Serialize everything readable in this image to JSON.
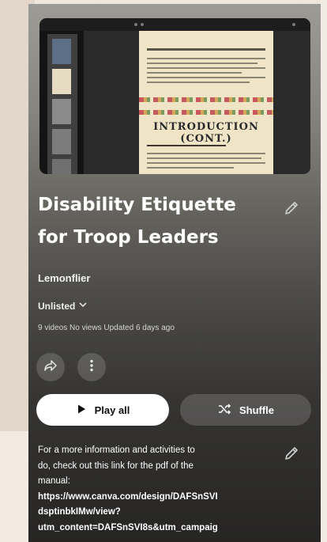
{
  "playlist": {
    "title_line1": "Disability Etiquette",
    "title_line2": "for Troop Leaders",
    "owner": "Lemonflier",
    "privacy": "Unlisted",
    "meta": "9 videos  No views  Updated 6 days ago"
  },
  "thumbnail": {
    "heading": "INTRODUCTION (CONT.)"
  },
  "actions": {
    "play_all_label": "Play all",
    "shuffle_label": "Shuffle"
  },
  "description": {
    "text_line1": "For a more information and activities to",
    "text_line2": "do, check out this link for the pdf of the",
    "text_line3": "manual:",
    "link_line1": "https://www.canva.com/design/DAFSnSVI",
    "link_line2": "dsptinbkIMw/view?",
    "link_line3": "utm_content=DAFSnSVI8s&utm_campaig"
  },
  "icons": {
    "edit_title": "pencil-icon",
    "edit_description": "pencil-icon",
    "share": "share-icon",
    "more": "more-vert-icon",
    "play": "play-icon",
    "shuffle": "shuffle-icon",
    "dropdown": "chevron-down-icon"
  },
  "colors": {
    "play_button_bg": "#ffffff",
    "text_primary": "#ffffff"
  }
}
